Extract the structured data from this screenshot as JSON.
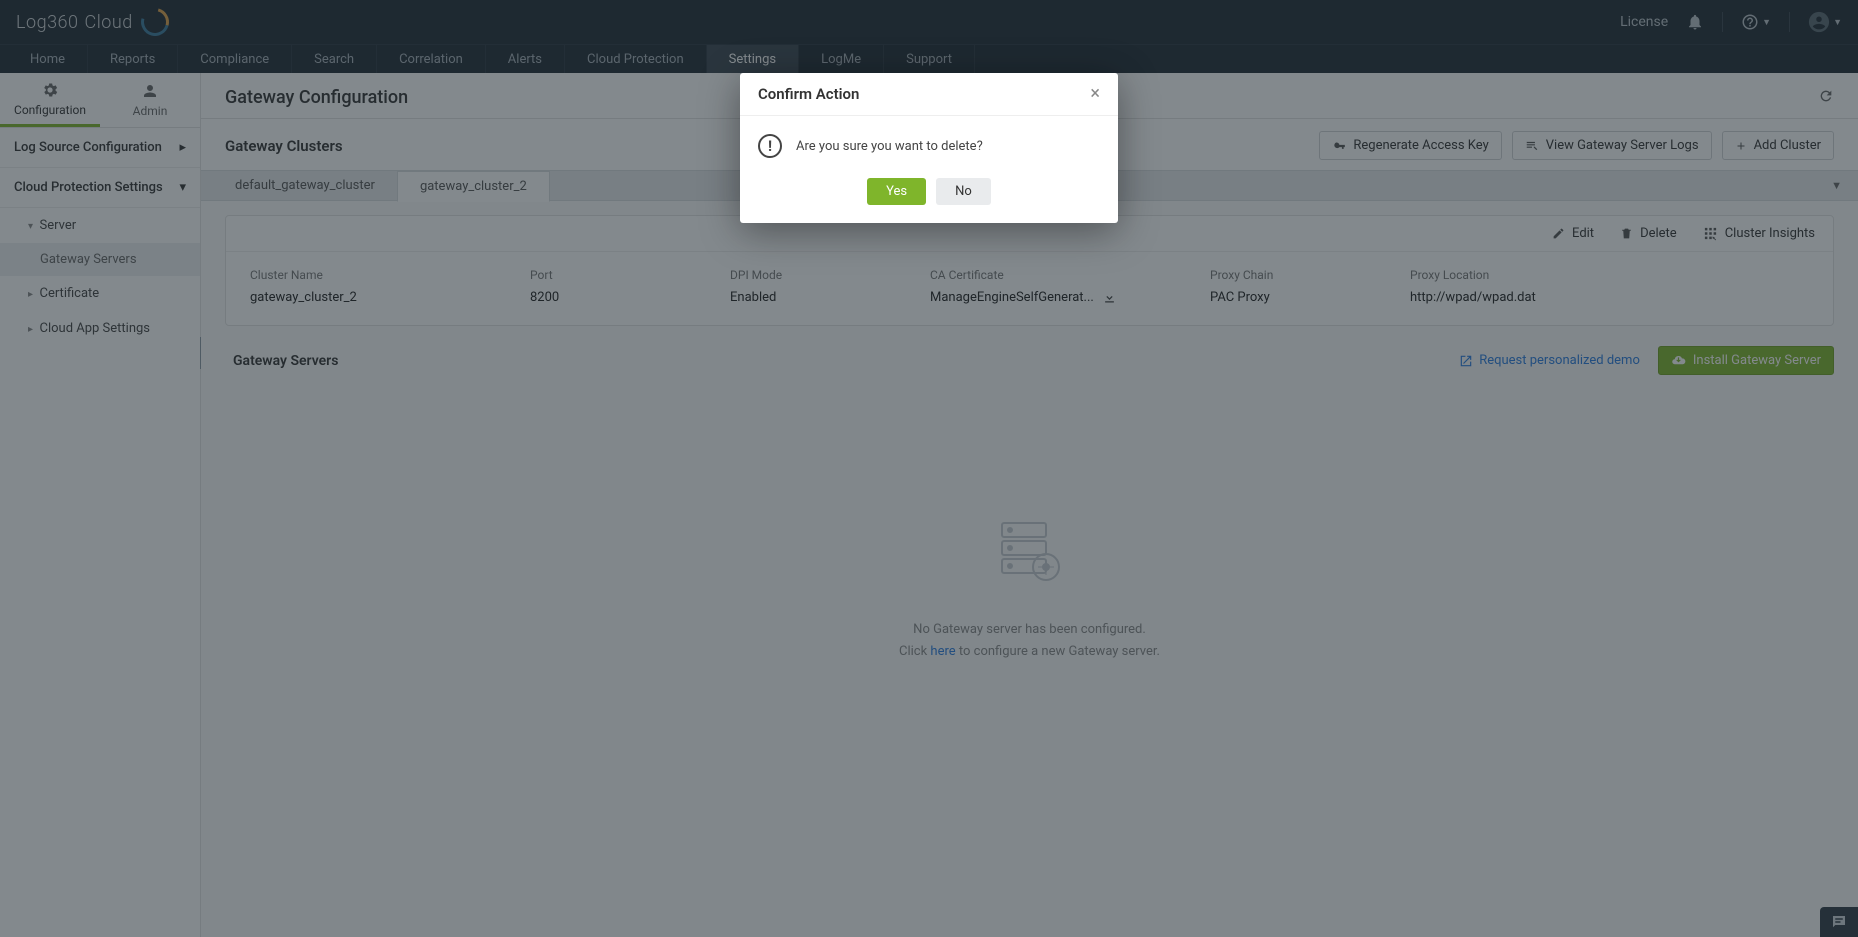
{
  "brand": {
    "name": "Log360",
    "suffix": "Cloud"
  },
  "topbar": {
    "license": "License"
  },
  "nav": {
    "items": [
      "Home",
      "Reports",
      "Compliance",
      "Search",
      "Correlation",
      "Alerts",
      "Cloud Protection",
      "Settings",
      "LogMe",
      "Support"
    ],
    "active": "Settings"
  },
  "subtabs": {
    "config": "Configuration",
    "admin": "Admin"
  },
  "sidebar": {
    "logSource": "Log Source Configuration",
    "cloudProt": "Cloud Protection Settings",
    "server": "Server",
    "gatewayServers": "Gateway Servers",
    "certificate": "Certificate",
    "cloudApp": "Cloud App Settings"
  },
  "page": {
    "title": "Gateway Configuration",
    "clusters_title": "Gateway Clusters",
    "buttons": {
      "regen": "Regenerate Access Key",
      "viewLogs": "View Gateway Server Logs",
      "addCluster": "Add Cluster"
    },
    "clusterTabs": [
      "default_gateway_cluster",
      "gateway_cluster_2"
    ],
    "activeClusterTab": "gateway_cluster_2",
    "actions": {
      "edit": "Edit",
      "delete": "Delete",
      "insights": "Cluster Insights"
    },
    "fields": {
      "name_lbl": "Cluster Name",
      "name_val": "gateway_cluster_2",
      "port_lbl": "Port",
      "port_val": "8200",
      "dpi_lbl": "DPI Mode",
      "dpi_val": "Enabled",
      "ca_lbl": "CA Certificate",
      "ca_val": "ManageEngineSelfGenerat...",
      "proxy_lbl": "Proxy Chain",
      "proxy_val": "PAC Proxy",
      "loc_lbl": "Proxy Location",
      "loc_val": "http://wpad/wpad.dat"
    },
    "gs_title": "Gateway Servers",
    "demo_link": "Request personalized demo",
    "install_btn": "Install Gateway Server",
    "empty": {
      "line1": "No Gateway server has been configured.",
      "line2a": "Click ",
      "here": "here",
      "line2b": " to configure a new Gateway server."
    }
  },
  "modal": {
    "title": "Confirm Action",
    "body": "Are you sure you want to delete?",
    "yes": "Yes",
    "no": "No"
  }
}
